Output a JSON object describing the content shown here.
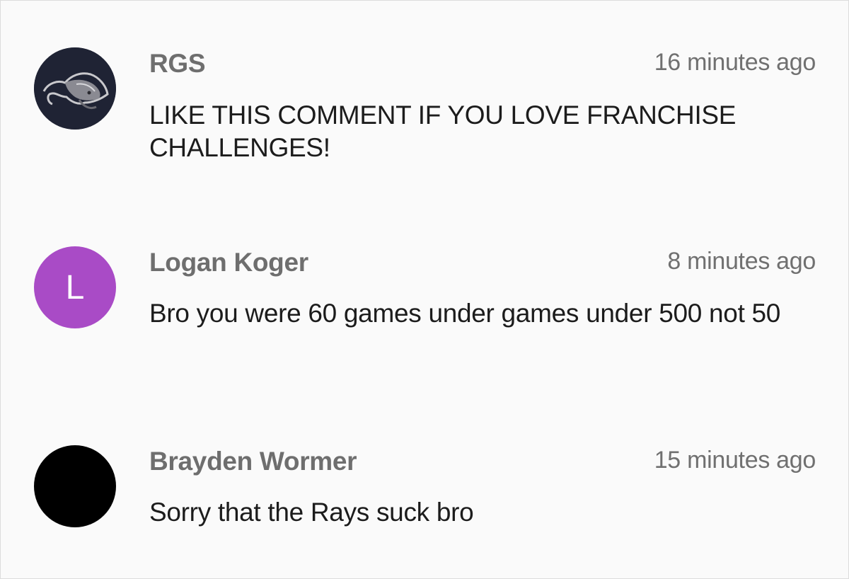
{
  "comments": [
    {
      "author": "RGS",
      "time": "16 minutes ago",
      "text": "LIKE THIS COMMENT IF YOU LOVE FRANCHISE CHALLENGES!",
      "avatar": {
        "type": "image",
        "icon": "stingray-icon",
        "bg": "#1e2233"
      }
    },
    {
      "author": "Logan Koger",
      "time": "8 minutes ago",
      "text": "Bro you were 60 games under games under 500 not 50",
      "avatar": {
        "type": "letter",
        "letter": "L",
        "bg": "#a94bc6"
      }
    },
    {
      "author": "Brayden Wormer",
      "time": "15 minutes ago",
      "text": "Sorry that the Rays suck bro",
      "avatar": {
        "type": "solid",
        "bg": "#000000"
      }
    }
  ]
}
